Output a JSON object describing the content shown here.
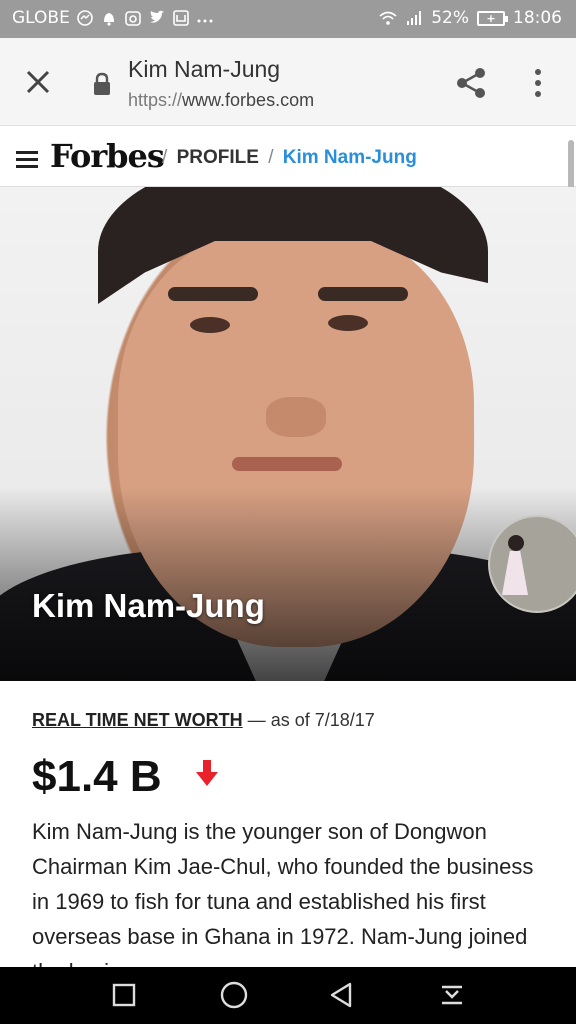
{
  "status_bar": {
    "carrier": "GLOBE",
    "battery": "52%",
    "time": "18:06",
    "icons": [
      "messenger-icon",
      "notification-icon",
      "instagram-icon",
      "twitter-icon",
      "app-icon",
      "more-icon",
      "wifi-icon",
      "signal-icon",
      "battery-icon"
    ]
  },
  "browser": {
    "page_title": "Kim Nam-Jung",
    "url_protocol": "https://",
    "url_host": "www.forbes.com",
    "load_progress": 0.86
  },
  "site_nav": {
    "logo": "Forbes",
    "separator": "/",
    "section": "PROFILE",
    "current": "Kim Nam-Jung"
  },
  "hero": {
    "name": "Kim Nam-Jung"
  },
  "net_worth": {
    "label": "REAL TIME NET WORTH",
    "dash": "—",
    "as_of": "as of 7/18/17",
    "value": "$1.4 B",
    "trend": "down"
  },
  "bio": {
    "text": "Kim Nam-Jung is the younger son of Dongwon Chairman Kim Jae-Chul, who founded the business in 1969 to fish for tuna and established his first overseas base in Ghana in 1972. Nam-Jung joined the business"
  },
  "colors": {
    "link_blue": "#2a8ed9",
    "arrow_red": "#e8212b",
    "status_gray": "#9b9b9b"
  }
}
